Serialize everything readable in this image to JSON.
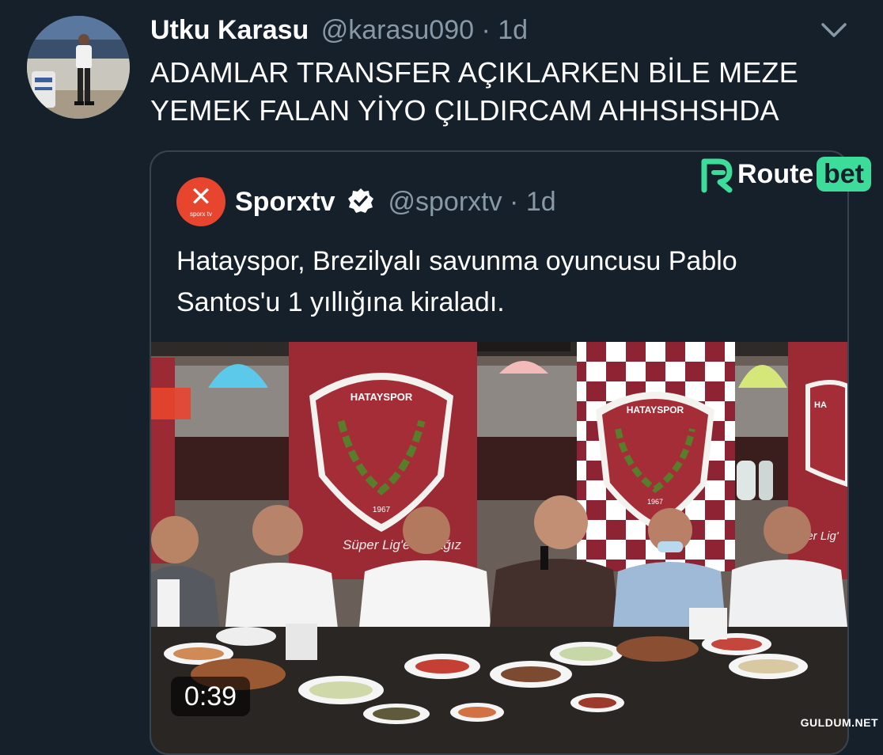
{
  "tweet": {
    "author_name": "Utku Karasu",
    "handle_time": "@karasu090 · 1d",
    "text": "ADAMLAR TRANSFER AÇIKLARKEN BİLE MEZE YEMEK FALAN YİYO ÇILDIRCAM AHHSHSHDA",
    "menu_icon": "chevron-down-icon"
  },
  "quoted_tweet": {
    "author_name": "Sporxtv",
    "verified_icon": "verified-badge-icon",
    "handle_time": "@sporxtv · 1d",
    "text": "Hatayspor, Brezilyalı savunma oyuncusu Pablo Santos'u 1 yıllığına kiraladı.",
    "logo_text": "sporx tv",
    "video": {
      "duration": "0:39",
      "banner_text_left": "HATAYSPOR",
      "banner_year_left": "1967",
      "banner_text_right": "HATAYSPOR",
      "banner_year_right": "1967",
      "banner_slogan": "Süper Lig'e Tat ağız",
      "banner_slogan_right": "per Lig'",
      "corner_text": "HA"
    }
  },
  "overlays": {
    "brand_route": "Route",
    "brand_bet": "bet",
    "watermark": "GULDUM.NET"
  },
  "colors": {
    "background": "#15202b",
    "secondary_text": "#8899a6",
    "border": "#38444d",
    "verified": "#ffffff",
    "routebet_accent": "#3ddc9b",
    "sporx_red": "#e8452e",
    "hatay_maroon": "#7a1e2c"
  }
}
